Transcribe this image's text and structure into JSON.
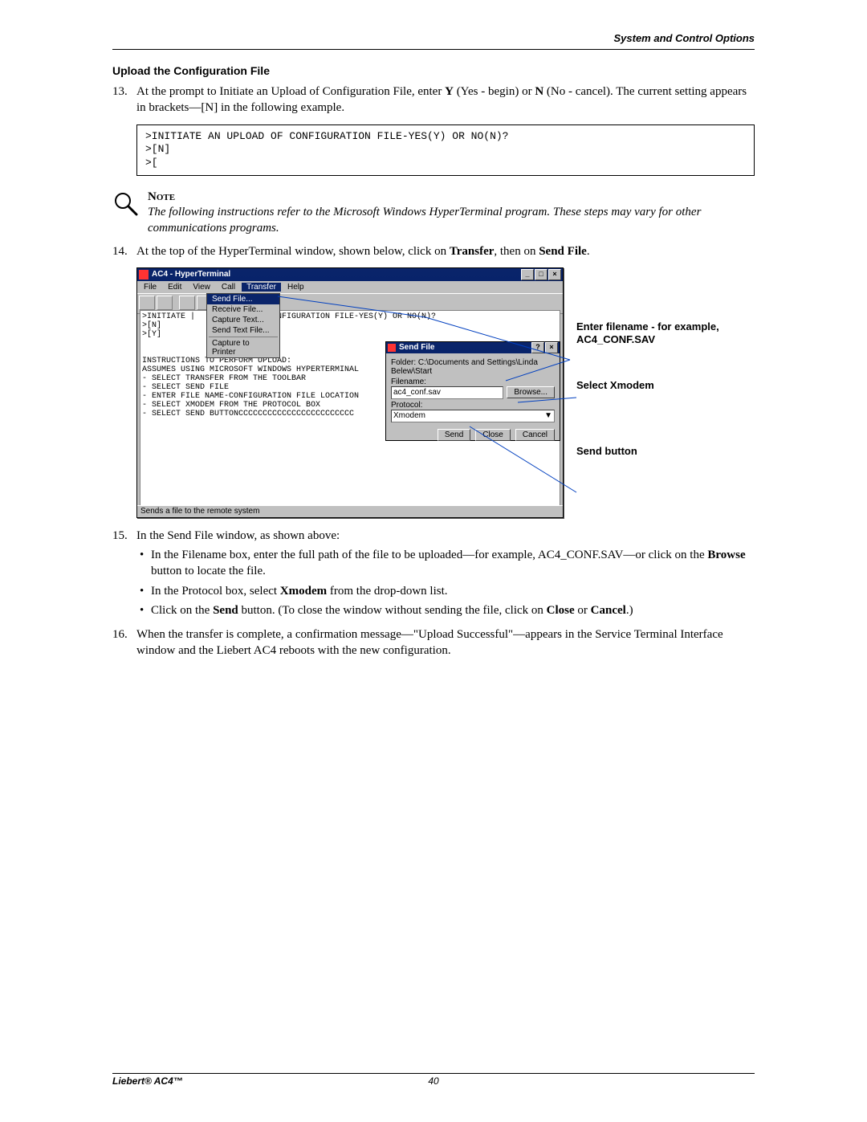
{
  "header_right": "System and Control Options",
  "section_title": "Upload the Configuration File",
  "step13_num": "13.",
  "step13_a": "At the prompt to Initiate an Upload of Configuration File, enter ",
  "step13_y": "Y",
  "step13_b": " (Yes - begin) or ",
  "step13_n": "N",
  "step13_c": " (No - cancel). The current setting appears in brackets—[N] in the following example.",
  "codebox": ">INITIATE AN UPLOAD OF CONFIGURATION FILE-YES(Y) OR NO(N)?\n>[N]\n>[",
  "note_title": "Note",
  "note_text": "The following instructions refer to the Microsoft Windows HyperTerminal program. These steps may vary for other communications programs.",
  "step14_num": "14.",
  "step14_a": "At the top of the HyperTerminal window, shown below, click on ",
  "step14_b": "Transfer",
  "step14_c": ", then on ",
  "step14_d": "Send File",
  "step14_e": ".",
  "ht": {
    "title": "AC4 - HyperTerminal",
    "menu": {
      "file": "File",
      "edit": "Edit",
      "view": "View",
      "call": "Call",
      "transfer": "Transfer",
      "help": "Help"
    },
    "menu_items": {
      "send_file": "Send File...",
      "receive_file": "Receive File...",
      "capture_text": "Capture Text...",
      "send_text_file": "Send Text File...",
      "capture_to_printer": "Capture to Printer"
    },
    "terminal_text": ">INITIATE |               CONFIGURATION FILE-YES(Y) OR NO(N)?\n>[N]\n>[Y]\n\n\nINSTRUCTIONS TO PERFORM UPLOAD:\nASSUMES USING MICROSOFT WINDOWS HYPERTERMINAL\n- SELECT TRANSFER FROM THE TOOLBAR\n- SELECT SEND FILE\n- ENTER FILE NAME-CONFIGURATION FILE LOCATION\n- SELECT XMODEM FROM THE PROTOCOL BOX\n- SELECT SEND BUTTONCCCCCCCCCCCCCCCCCCCCCCCC",
    "status": "Sends a file to the remote system"
  },
  "sendfile": {
    "title": "Send File",
    "folder_label": "Folder: C:\\Documents and Settings\\Linda Belew\\Start",
    "filename_label": "Filename:",
    "filename_value": "ac4_conf.sav",
    "browse": "Browse...",
    "protocol_label": "Protocol:",
    "protocol_value": "Xmodem",
    "send": "Send",
    "close": "Close",
    "cancel": "Cancel"
  },
  "callouts": {
    "filename": "Enter filename - for example, AC4_CONF.SAV",
    "xmodem": "Select Xmodem",
    "sendbtn": "Send button"
  },
  "step15_num": "15.",
  "step15_intro": "In the Send File window, as shown above:",
  "step15_b1a": "In the Filename box, enter the full path of the file to be uploaded—for example, AC4_CONF.SAV—or click on the ",
  "step15_b1b": "Browse",
  "step15_b1c": " button to locate the file.",
  "step15_b2a": "In the Protocol box, select ",
  "step15_b2b": "Xmodem",
  "step15_b2c": " from the drop-down list.",
  "step15_b3a": "Click on the ",
  "step15_b3b": "Send",
  "step15_b3c": " button. (To close the window without sending the file, click on ",
  "step15_b3d": "Close",
  "step15_b3e": " or ",
  "step15_b3f": "Cancel",
  "step15_b3g": ".)",
  "step16_num": "16.",
  "step16": "When the transfer is complete, a confirmation message—\"Upload Successful\"—appears in the Service Terminal Interface window and the Liebert AC4 reboots with the new configuration.",
  "footer_product": "Liebert® AC4™",
  "footer_page": "40"
}
